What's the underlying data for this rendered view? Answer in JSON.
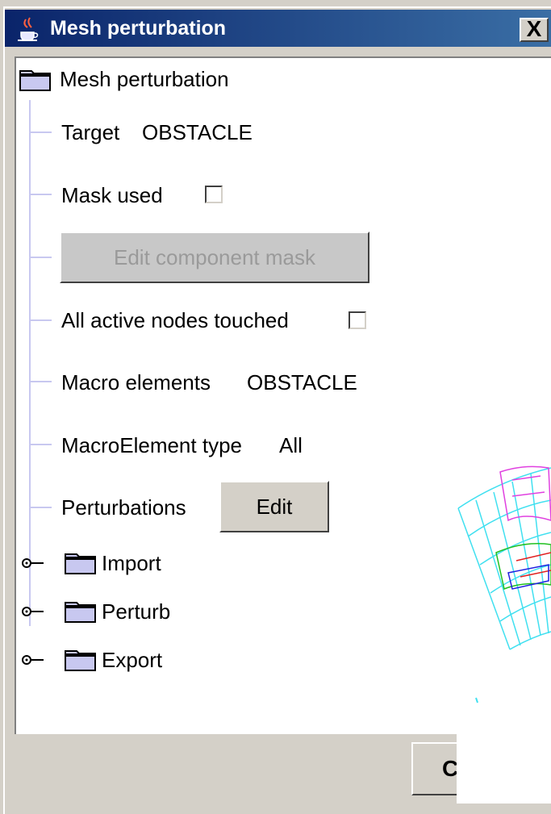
{
  "window": {
    "title": "Mesh perturbation",
    "close_label": "X"
  },
  "tree": {
    "root_label": "Mesh perturbation",
    "target_label": "Target",
    "target_value": "OBSTACLE",
    "mask_used_label": "Mask used",
    "mask_used_checked": false,
    "edit_mask_button": "Edit component mask",
    "all_active_label": "All active nodes touched",
    "all_active_checked": false,
    "macro_elements_label": "Macro elements",
    "macro_elements_value": "OBSTACLE",
    "macro_type_label": "MacroElement type",
    "macro_type_value": "All",
    "perturbations_label": "Perturbations",
    "edit_button": "Edit",
    "folders": [
      "Import",
      "Perturb",
      "Export"
    ]
  },
  "footer": {
    "partial_button": "C"
  },
  "colors": {
    "title_bar": "#0a246a",
    "tree_line": "#c8c8f0",
    "folder": "#c8c8f0"
  }
}
